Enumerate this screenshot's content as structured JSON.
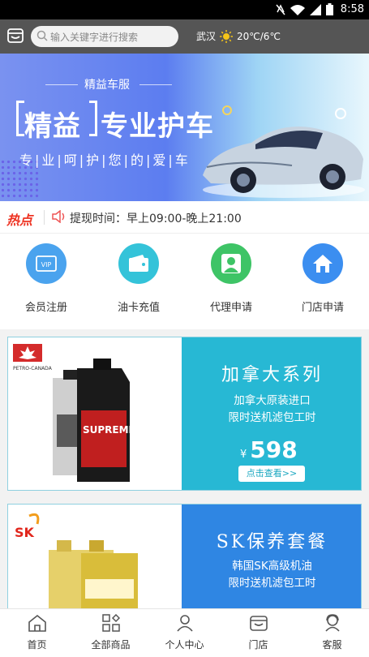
{
  "status": {
    "time": "8:58"
  },
  "header": {
    "search_placeholder": "输入关键字进行搜索",
    "city": "武汉",
    "temperature": "20℃/6℃"
  },
  "banner": {
    "brand": "精益车服",
    "headline_a": "精益",
    "headline_b": "专业护车",
    "tagline": "专|业|呵|护|您|的|爱|车",
    "page_count": 2,
    "current_page": 1
  },
  "notice": {
    "tag": "热点",
    "text": "提现时间：早上09:00-晚上21:00"
  },
  "quick_menu": [
    {
      "label": "会员注册",
      "icon": "vip-icon",
      "color": "#4aa3ee"
    },
    {
      "label": "油卡充值",
      "icon": "wallet-icon",
      "color": "#34c3d9"
    },
    {
      "label": "代理申请",
      "icon": "person-icon",
      "color": "#3ec466"
    },
    {
      "label": "门店申请",
      "icon": "home-icon",
      "color": "#3b8ef0"
    }
  ],
  "promos": [
    {
      "brand_logo": "PETRO-CANADA",
      "product": "SUPREME 10W-30",
      "title": "加拿大系列",
      "line1": "加拿大原装进口",
      "line2": "限时送机滤包工时",
      "currency": "¥",
      "price": "598",
      "button": "点击查看>>",
      "color": "#27b8d4"
    },
    {
      "brand_logo": "SK",
      "title": "SK保养套餐",
      "line1": "韩国SK高级机油",
      "line2": "限时送机滤包工时",
      "color": "#2f86e3"
    }
  ],
  "tabbar": [
    {
      "label": "首页",
      "icon": "home-icon"
    },
    {
      "label": "全部商品",
      "icon": "grid-icon"
    },
    {
      "label": "个人中心",
      "icon": "user-icon"
    },
    {
      "label": "门店",
      "icon": "store-icon"
    },
    {
      "label": "客服",
      "icon": "headset-icon"
    }
  ]
}
